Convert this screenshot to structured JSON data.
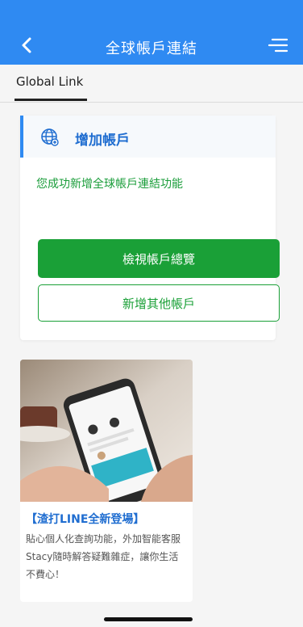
{
  "header": {
    "title": "全球帳戶連結"
  },
  "tabs": [
    {
      "label": "Global Link"
    }
  ],
  "add_account_card": {
    "title": "增加帳戶",
    "success_message": "您成功新增全球帳戶連結功能",
    "view_overview_button": "檢視帳戶總覽",
    "add_other_button": "新增其他帳戶"
  },
  "promo": {
    "title": "【渣打LINE全新登場】",
    "description": "貼心個人化查詢功能，外加智能客服Stacy隨時解答疑難雜症，讓你生活不費心！"
  },
  "colors": {
    "header_bg": "#2f8af2",
    "accent_blue": "#1f6dd0",
    "primary_green": "#1aa037"
  }
}
